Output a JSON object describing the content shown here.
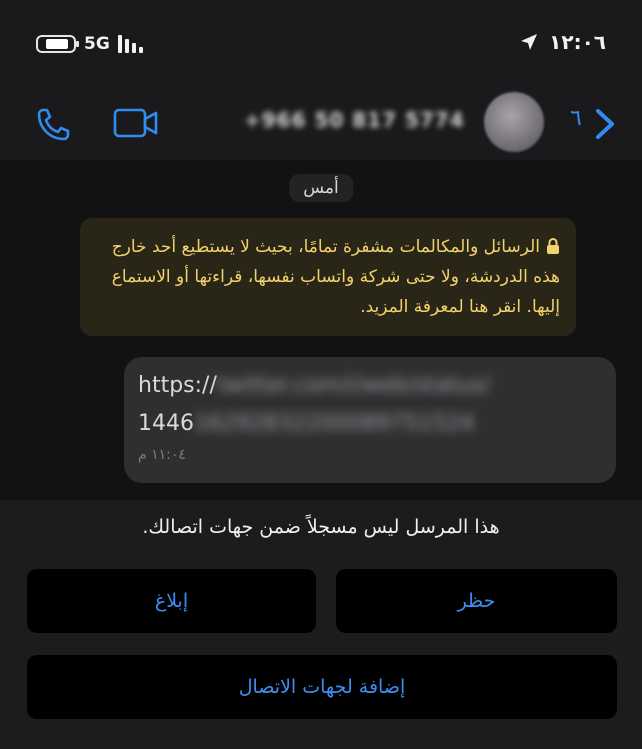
{
  "status_bar": {
    "network": "5G",
    "time": "١٢:٠٦"
  },
  "header": {
    "contact_name": "+966 50 817 5774",
    "back_count": "٦"
  },
  "chat": {
    "date_label": "أمس",
    "encryption_notice": "الرسائل والمكالمات مشفرة تمامًا، بحيث لا يستطيع أحد خارج هذه الدردشة، ولا حتى شركة واتساب نفسها، قراءتها أو الاستماع إليها. انقر هنا لمعرفة المزيد.",
    "message": {
      "url_line1_prefix": "https://",
      "url_line1_blurred": "twitter.com/i/web/status/",
      "url_line2_prefix": "1446",
      "url_line2_blurred": "16292832200089751524",
      "time": "١١:٠٤ م"
    }
  },
  "panel": {
    "notice": "هذا المرسل ليس مسجلاً ضمن جهات اتصالك.",
    "report_label": "إبلاغ",
    "block_label": "حظر",
    "add_contact_label": "إضافة لجهات الاتصال"
  },
  "colors": {
    "accent": "#2f8cf0",
    "encryption_bg": "#2a2617",
    "encryption_text": "#f2d36b"
  }
}
